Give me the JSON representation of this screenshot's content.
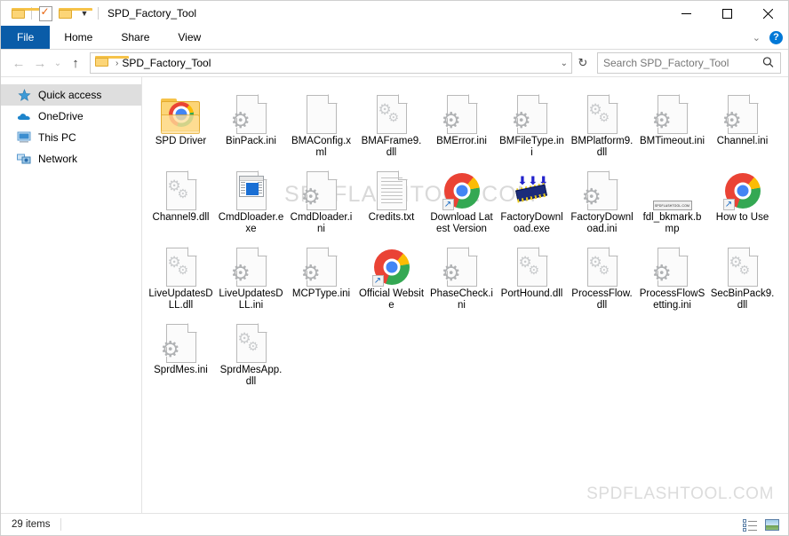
{
  "window": {
    "title": "SPD_Factory_Tool",
    "quick_access": [
      {
        "name": "folder-icon",
        "label": ""
      },
      {
        "name": "properties-icon",
        "label": ""
      },
      {
        "name": "new-folder-icon",
        "label": ""
      },
      {
        "name": "customize-qat-chevron",
        "label": "▾"
      }
    ],
    "controls": {
      "minimize": "—",
      "maximize": "☐",
      "close": "✕"
    }
  },
  "ribbon": {
    "tabs": [
      {
        "label": "File",
        "active": true
      },
      {
        "label": "Home",
        "active": false
      },
      {
        "label": "Share",
        "active": false
      },
      {
        "label": "View",
        "active": false
      }
    ],
    "collapse_chevron": "⌄",
    "help_label": "?"
  },
  "address": {
    "back": "←",
    "forward": "→",
    "recent": "⌄",
    "up": "↑",
    "breadcrumb_separator": "›",
    "path": "SPD_Factory_Tool",
    "dropdown": "⌄",
    "refresh": "↻"
  },
  "search": {
    "placeholder": "Search SPD_Factory_Tool",
    "icon": "search-icon"
  },
  "sidebar": {
    "items": [
      {
        "label": "Quick access",
        "icon": "star-icon",
        "selected": true
      },
      {
        "label": "OneDrive",
        "icon": "cloud-icon",
        "selected": false
      },
      {
        "label": "This PC",
        "icon": "computer-icon",
        "selected": false
      },
      {
        "label": "Network",
        "icon": "network-icon",
        "selected": false
      }
    ]
  },
  "files": [
    {
      "name": "SPD Driver",
      "type": "folder-driver"
    },
    {
      "name": "BinPack.ini",
      "type": "ini"
    },
    {
      "name": "BMAConfig.xml",
      "type": "blank"
    },
    {
      "name": "BMAFrame9.dll",
      "type": "dll"
    },
    {
      "name": "BMError.ini",
      "type": "ini"
    },
    {
      "name": "BMFileType.ini",
      "type": "ini"
    },
    {
      "name": "BMPlatform9.dll",
      "type": "dll"
    },
    {
      "name": "BMTimeout.ini",
      "type": "ini"
    },
    {
      "name": "Channel.ini",
      "type": "ini"
    },
    {
      "name": "Channel9.dll",
      "type": "dll"
    },
    {
      "name": "CmdDloader.exe",
      "type": "exe-app"
    },
    {
      "name": "CmdDloader.ini",
      "type": "ini"
    },
    {
      "name": "Credits.txt",
      "type": "txt"
    },
    {
      "name": "Download Latest Version",
      "type": "chrome-shortcut"
    },
    {
      "name": "FactoryDownload.exe",
      "type": "exe-chip"
    },
    {
      "name": "FactoryDownload.ini",
      "type": "ini"
    },
    {
      "name": "fdl_bkmark.bmp",
      "type": "bmp",
      "thumb_text": "SPDFLASHTOOL.COM"
    },
    {
      "name": "How to Use",
      "type": "chrome-shortcut"
    },
    {
      "name": "LiveUpdatesDLL.dll",
      "type": "dll"
    },
    {
      "name": "LiveUpdatesDLL.ini",
      "type": "ini"
    },
    {
      "name": "MCPType.ini",
      "type": "ini"
    },
    {
      "name": "Official Website",
      "type": "chrome-shortcut"
    },
    {
      "name": "PhaseCheck.ini",
      "type": "ini"
    },
    {
      "name": "PortHound.dll",
      "type": "dll"
    },
    {
      "name": "ProcessFlow.dll",
      "type": "dll"
    },
    {
      "name": "ProcessFlowSetting.ini",
      "type": "ini"
    },
    {
      "name": "SecBinPack9.dll",
      "type": "dll"
    },
    {
      "name": "SprdMes.ini",
      "type": "ini"
    },
    {
      "name": "SprdMesApp.dll",
      "type": "dll"
    }
  ],
  "watermarks": {
    "top": "SPDFLASHTOOL.COM",
    "bottom": "SPDFLASHTOOL.COM"
  },
  "status": {
    "item_count": "29 items",
    "views": [
      {
        "name": "details-view-button"
      },
      {
        "name": "large-icons-view-button"
      }
    ]
  },
  "colors": {
    "file_tab_blue": "#0a5ca8",
    "selection_gray": "#dedede",
    "help_blue": "#0078d7",
    "watermark_gray": "#d9d9d9"
  }
}
